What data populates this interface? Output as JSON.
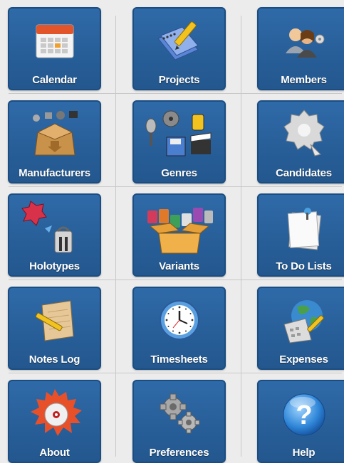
{
  "tiles": [
    {
      "label": "Calendar",
      "icon": "calendar-icon"
    },
    {
      "label": "Projects",
      "icon": "projects-icon"
    },
    {
      "label": "Members",
      "icon": "members-icon"
    },
    {
      "label": "Manufacturers",
      "icon": "manufacturers-icon"
    },
    {
      "label": "Genres",
      "icon": "genres-icon"
    },
    {
      "label": "Candidates",
      "icon": "candidates-icon"
    },
    {
      "label": "Holotypes",
      "icon": "holotypes-icon"
    },
    {
      "label": "Variants",
      "icon": "variants-icon"
    },
    {
      "label": "To Do Lists",
      "icon": "todo-lists-icon"
    },
    {
      "label": "Notes Log",
      "icon": "notes-log-icon"
    },
    {
      "label": "Timesheets",
      "icon": "timesheets-icon"
    },
    {
      "label": "Expenses",
      "icon": "expenses-icon"
    },
    {
      "label": "About",
      "icon": "about-icon"
    },
    {
      "label": "Preferences",
      "icon": "preferences-icon"
    },
    {
      "label": "Help",
      "icon": "help-icon"
    }
  ],
  "colors": {
    "tile": "#2f6aa8",
    "tile_border": "#1b4d82",
    "background": "#ececec"
  }
}
